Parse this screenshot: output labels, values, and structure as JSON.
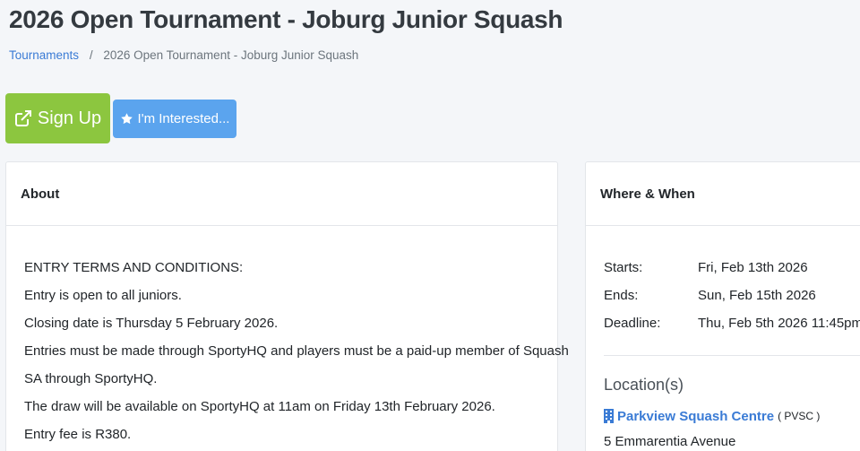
{
  "page": {
    "title": "2026 Open Tournament - Joburg Junior Squash"
  },
  "breadcrumb": {
    "root": "Tournaments",
    "separator": "/",
    "current": "2026 Open Tournament - Joburg Junior Squash"
  },
  "actions": {
    "signup_label": "Sign Up",
    "interested_label": "I'm Interested...",
    "signup_icon": "external-link-icon",
    "interested_icon": "star-icon",
    "signup_color": "#8cc63f",
    "interested_color": "#5ba4ee"
  },
  "about": {
    "heading": "About",
    "lines": [
      "ENTRY TERMS AND CONDITIONS:",
      "Entry is open to all juniors.",
      "Closing date is Thursday 5 February 2026.",
      "Entries must be made through SportyHQ and players must be a paid-up member of Squash",
      "SA through SportyHQ.",
      "The draw will be available on SportyHQ at 11am on Friday 13th February 2026.",
      "Entry fee is R380."
    ]
  },
  "where_when": {
    "heading": "Where & When",
    "dates": [
      {
        "label": "Starts:",
        "value": "Fri, Feb 13th 2026"
      },
      {
        "label": "Ends:",
        "value": "Sun, Feb 15th 2026"
      },
      {
        "label": "Deadline:",
        "value": "Thu, Feb 5th 2026 11:45pm"
      }
    ],
    "location_heading": "Location(s)",
    "venue_icon": "building-icon",
    "venue_name": "Parkview Squash Centre",
    "venue_abbr": "( PVSC )",
    "address_line1": "5 Emmarentia Avenue"
  }
}
